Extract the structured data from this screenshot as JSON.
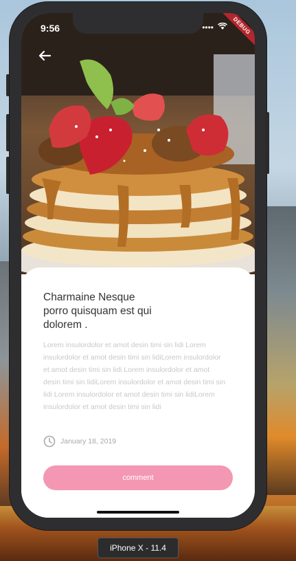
{
  "status_bar": {
    "time": "9:56",
    "debug_banner": "DEBUG"
  },
  "nav": {
    "back_icon": "arrow-left-icon"
  },
  "article": {
    "title": "Charmaine Nesque porro quisquam est qui dolorem .",
    "body": "Lorem insulordolor et amot desin timi sin lidi Lorem insulordolor et amot desin timi sin lidiLorem insulordolor et amot desin timi sin lidi Lorem insulordolor et amot desin timi sin lidiLorem insulordolor et amot desin timi sin lidi Lorem insulordolor et amot desin timi sin lidiLorem insulordolor et amot desin timi sin lidi",
    "date": "January 18, 2019",
    "date_icon": "clock-icon",
    "comment_label": "comment"
  },
  "simulator": {
    "device_label": "iPhone X - 11.4"
  },
  "colors": {
    "accent": "#f497b3",
    "debug": "#b3262e"
  }
}
